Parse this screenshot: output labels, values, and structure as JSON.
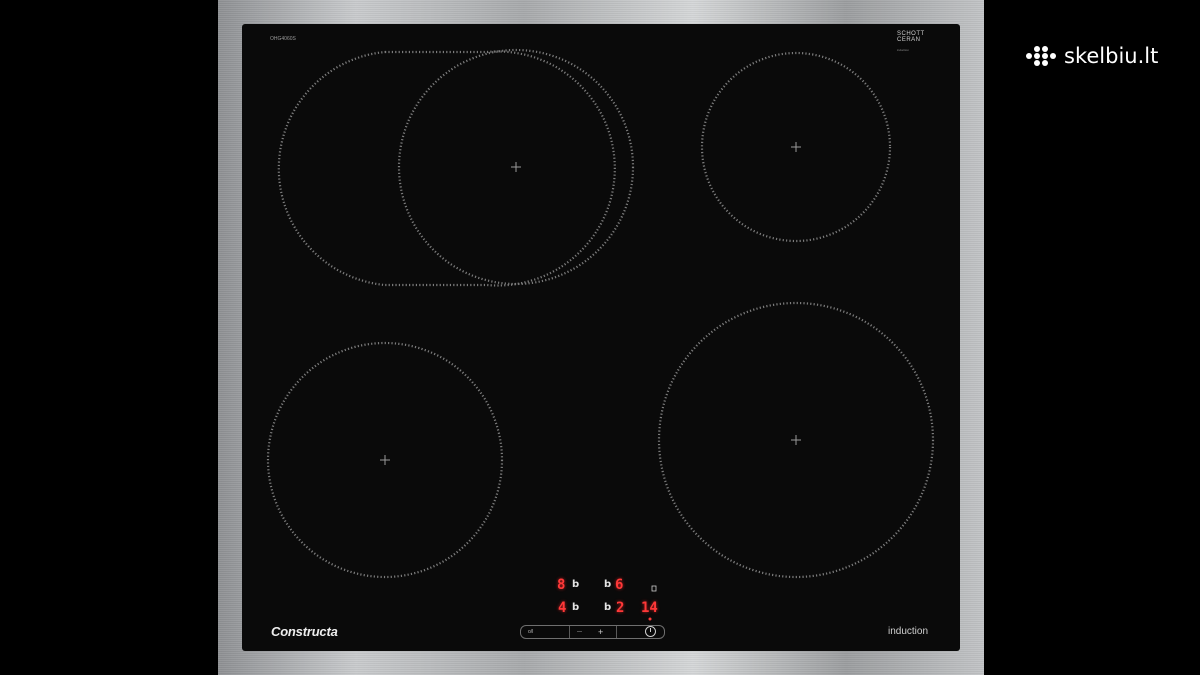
{
  "hob": {
    "model_code": "OHG4060S",
    "glass_maker": "SCHOTT",
    "glass_type": "CERAN",
    "glass_sub": "induction",
    "brand": "Constructa",
    "type_label": "induction"
  },
  "display": {
    "digits": [
      "8",
      "6",
      "4",
      "2",
      "14"
    ]
  },
  "watermark": {
    "site": "skelbiu.lt"
  },
  "colors": {
    "glass": "#0a0a0a",
    "frame": "#b8babc",
    "led": "#ff3838"
  }
}
